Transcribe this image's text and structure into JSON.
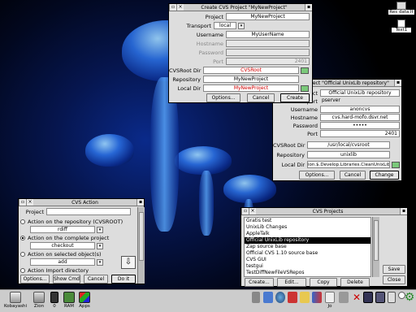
{
  "desktop": {
    "pinned_icons": [
      {
        "label": "Res data.lt",
        "icon": "floppy-disc-icon"
      },
      {
        "label": "Text1",
        "icon": "text-file-icon"
      }
    ]
  },
  "create_window": {
    "title": "Create CVS Project \"MyNewProject\"",
    "labels": {
      "project": "Project",
      "transport": "Transport",
      "username": "Username",
      "hostname": "Hostname",
      "password": "Password",
      "port": "Port",
      "cvsroot_dir": "CVSRoot Dir",
      "repository": "Repository",
      "local_dir": "Local Dir"
    },
    "values": {
      "project": "MyNewProject",
      "transport": "local",
      "username": "MyUserName",
      "hostname": "",
      "password": "",
      "port": "2401",
      "cvsroot_dir": "CVSRoot",
      "repository": "MyNewProject",
      "local_dir": "MyNewProject"
    },
    "buttons": {
      "options": "Options...",
      "cancel": "Cancel",
      "create": "Create"
    }
  },
  "edit_window": {
    "title": "Edit Project \"Official UnixLib repository\"",
    "values": {
      "project": "Official UnixLib repository",
      "transport": "pserver",
      "username": "anoncvs",
      "hostname": "cvs.hard-mofo.dsvr.net",
      "password": "•••••",
      "port": "2401",
      "cvsroot_dir": "/usr/local/cvsroot",
      "repository": "unixlib",
      "local_dir": "ion.$.Develop.Libraries.CleanUnixLib.unixlib"
    },
    "buttons": {
      "options": "Options...",
      "cancel": "Cancel",
      "change": "Change"
    }
  },
  "action_window": {
    "title": "CVS Action",
    "project_label": "Project",
    "options": [
      {
        "label": "Action on the repository (CVSROOT)",
        "selected": false,
        "value": "rdiff"
      },
      {
        "label": "Action on the complete project",
        "selected": true,
        "value": "checkout"
      },
      {
        "label": "Action on selected object(s)",
        "selected": false,
        "value": "add"
      },
      {
        "label": "Action Import directory",
        "selected": false,
        "value": ""
      }
    ],
    "buttons": {
      "options": "Options...",
      "show_cmd": "Show Cmd",
      "cancel": "Cancel",
      "do_it": "Do it"
    }
  },
  "projects_window": {
    "title": "CVS Projects",
    "items": [
      "Gratis test",
      "UnixLib Changes",
      "AppleTalk",
      "Official UnixLib repository",
      "Zap source base",
      "Official CVS 1.10 source base",
      "CVS GUI",
      "testgui",
      "TestDiffNewFileVSRepos"
    ],
    "selected_index": 3,
    "buttons": {
      "create": "Create...",
      "edit": "Edit...",
      "copy": "Copy",
      "delete": "Delete",
      "save": "Save",
      "close": "Close"
    }
  },
  "iconbar": {
    "left": [
      {
        "label": "Kobayashi",
        "icon": "hard-disc-icon"
      },
      {
        "label": "Zion",
        "icon": "network-drive-icon"
      },
      {
        "label": "0",
        "icon": "floppy-icon"
      },
      {
        "label": "RAM",
        "icon": "ram-disc-icon"
      },
      {
        "label": "Apps",
        "icon": "apps-icon"
      }
    ],
    "right": [
      {
        "label": "",
        "icon": "tool-icon"
      },
      {
        "label": "",
        "icon": "cvs-icon"
      },
      {
        "label": "",
        "icon": "globe-icon"
      },
      {
        "label": "",
        "icon": "shell-icon"
      },
      {
        "label": "",
        "icon": "folder-icon"
      },
      {
        "label": "",
        "icon": "chart-icon"
      },
      {
        "label": "Jo",
        "icon": "paint-icon"
      },
      {
        "label": "",
        "icon": "tools-icon"
      },
      {
        "label": "",
        "icon": "close-x-icon"
      },
      {
        "label": "",
        "icon": "monitor-icon"
      },
      {
        "label": "",
        "icon": "display-icon"
      },
      {
        "label": "",
        "icon": "printer-icon"
      },
      {
        "label": "",
        "icon": "clock-icon"
      },
      {
        "label": "",
        "icon": "gear-icon"
      }
    ]
  }
}
